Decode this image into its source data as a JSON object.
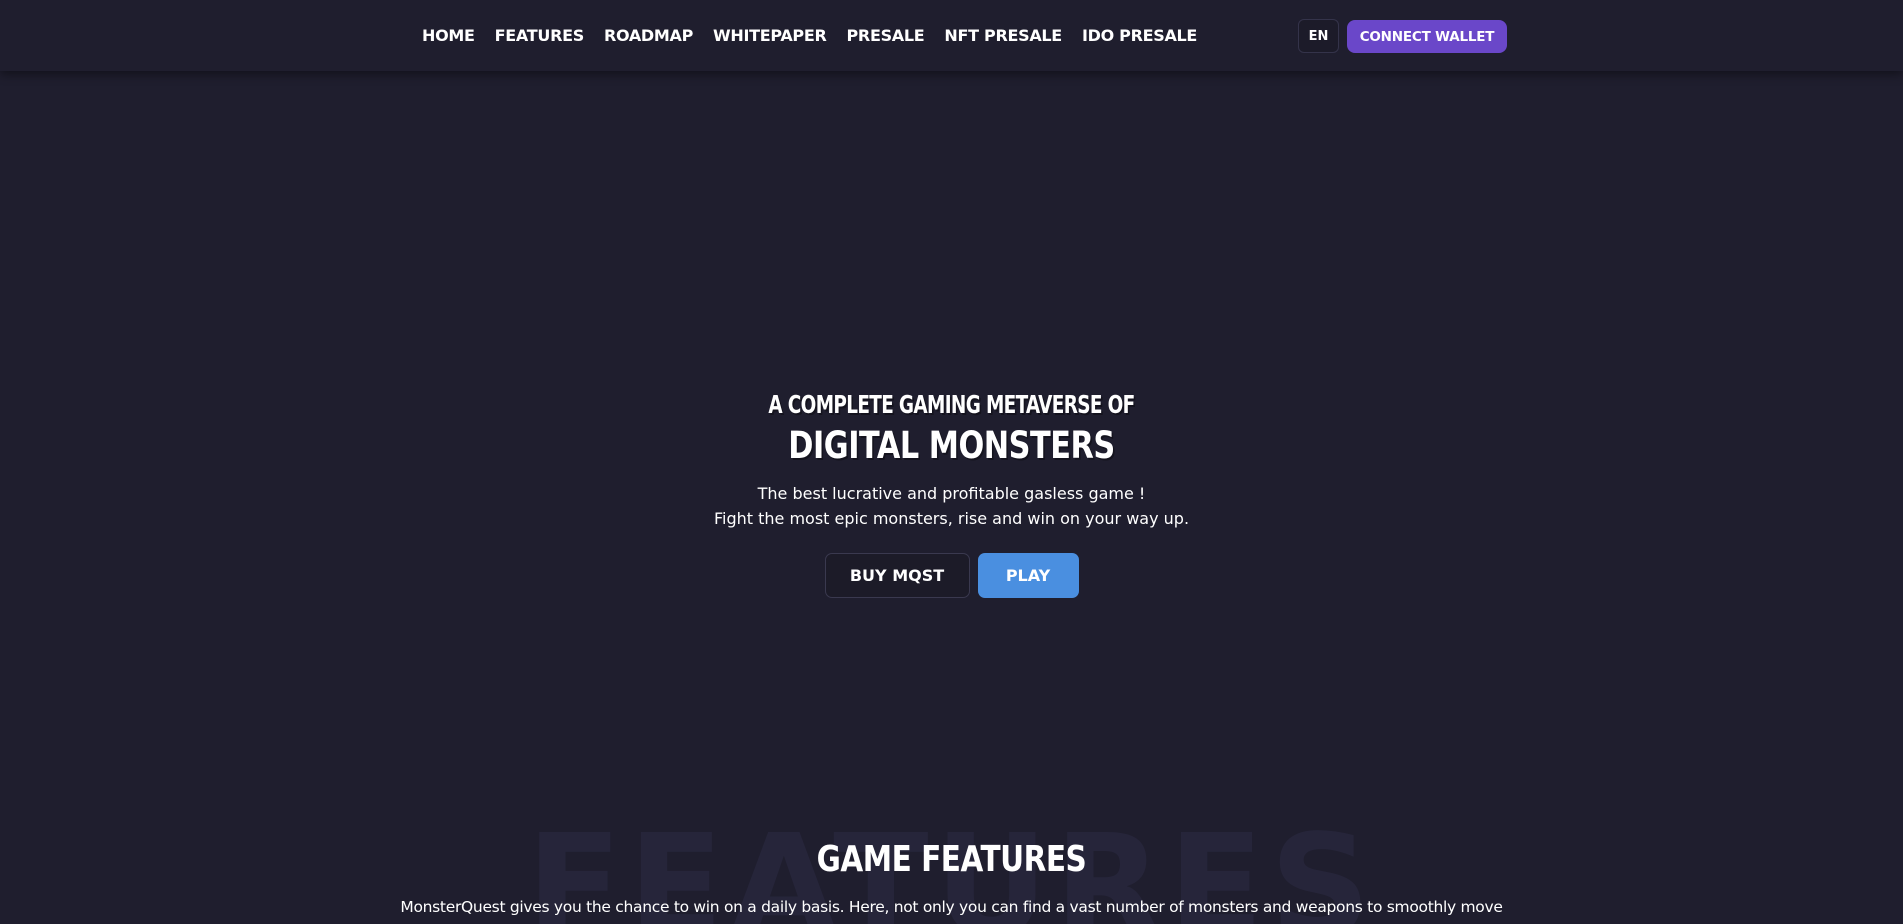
{
  "nav": {
    "items": [
      {
        "label": "HOME"
      },
      {
        "label": "FEATURES"
      },
      {
        "label": "ROADMAP"
      },
      {
        "label": "WHITEPAPER"
      },
      {
        "label": "PRESALE"
      },
      {
        "label": "NFT PRESALE"
      },
      {
        "label": "IDO PRESALE"
      }
    ],
    "language": "EN",
    "connect_wallet": "CONNECT WALLET"
  },
  "hero": {
    "pre_title": "A COMPLETE GAMING METAVERSE OF",
    "title": "DIGITAL MONSTERS",
    "subtitle_line1": "The best lucrative and profitable gasless game !",
    "subtitle_line2": "Fight the most epic monsters, rise and win on your way up.",
    "buy_button": "BUY MQST",
    "play_button": "PLAY"
  },
  "features": {
    "watermark": "FEATURES",
    "title": "GAME FEATURES",
    "description": "MonsterQuest gives you the chance to win on a daily basis. Here, not only you can find a vast number of monsters and weapons to smoothly move"
  },
  "colors": {
    "background": "#1f1e2e",
    "connect_button": "#6a47c9",
    "play_button": "#4a8fe0",
    "text": "#ffffff"
  }
}
